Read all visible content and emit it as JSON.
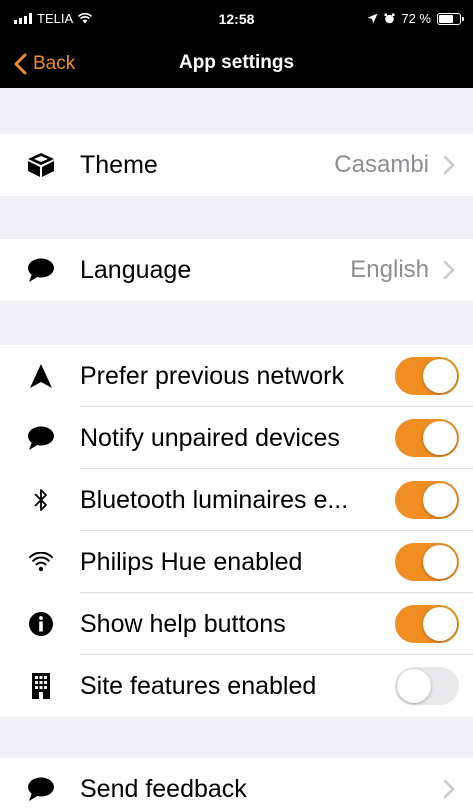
{
  "status_bar": {
    "carrier": "TELIA",
    "time": "12:58",
    "battery": "72 %",
    "battery_level": 0.72
  },
  "nav": {
    "back_label": "Back",
    "title": "App settings"
  },
  "colors": {
    "accent": "#f08e23",
    "background": "#efeff4",
    "toggle_off": "#e9e9eb"
  },
  "theme_row": {
    "label": "Theme",
    "value": "Casambi",
    "icon": "cube-icon"
  },
  "language_row": {
    "label": "Language",
    "value": "English",
    "icon": "speech-bubble-icon"
  },
  "toggles": [
    {
      "label": "Prefer previous network",
      "on": true,
      "icon": "navigation-arrow-icon"
    },
    {
      "label": "Notify unpaired devices",
      "on": true,
      "icon": "speech-bubble-icon"
    },
    {
      "label": "Bluetooth luminaires e...",
      "on": true,
      "icon": "bluetooth-icon"
    },
    {
      "label": "Philips Hue enabled",
      "on": true,
      "icon": "wifi-icon"
    },
    {
      "label": "Show help buttons",
      "on": true,
      "icon": "info-icon"
    },
    {
      "label": "Site features enabled",
      "on": false,
      "icon": "building-icon"
    }
  ],
  "feedback_row": {
    "label": "Send feedback",
    "icon": "speech-bubble-icon"
  }
}
